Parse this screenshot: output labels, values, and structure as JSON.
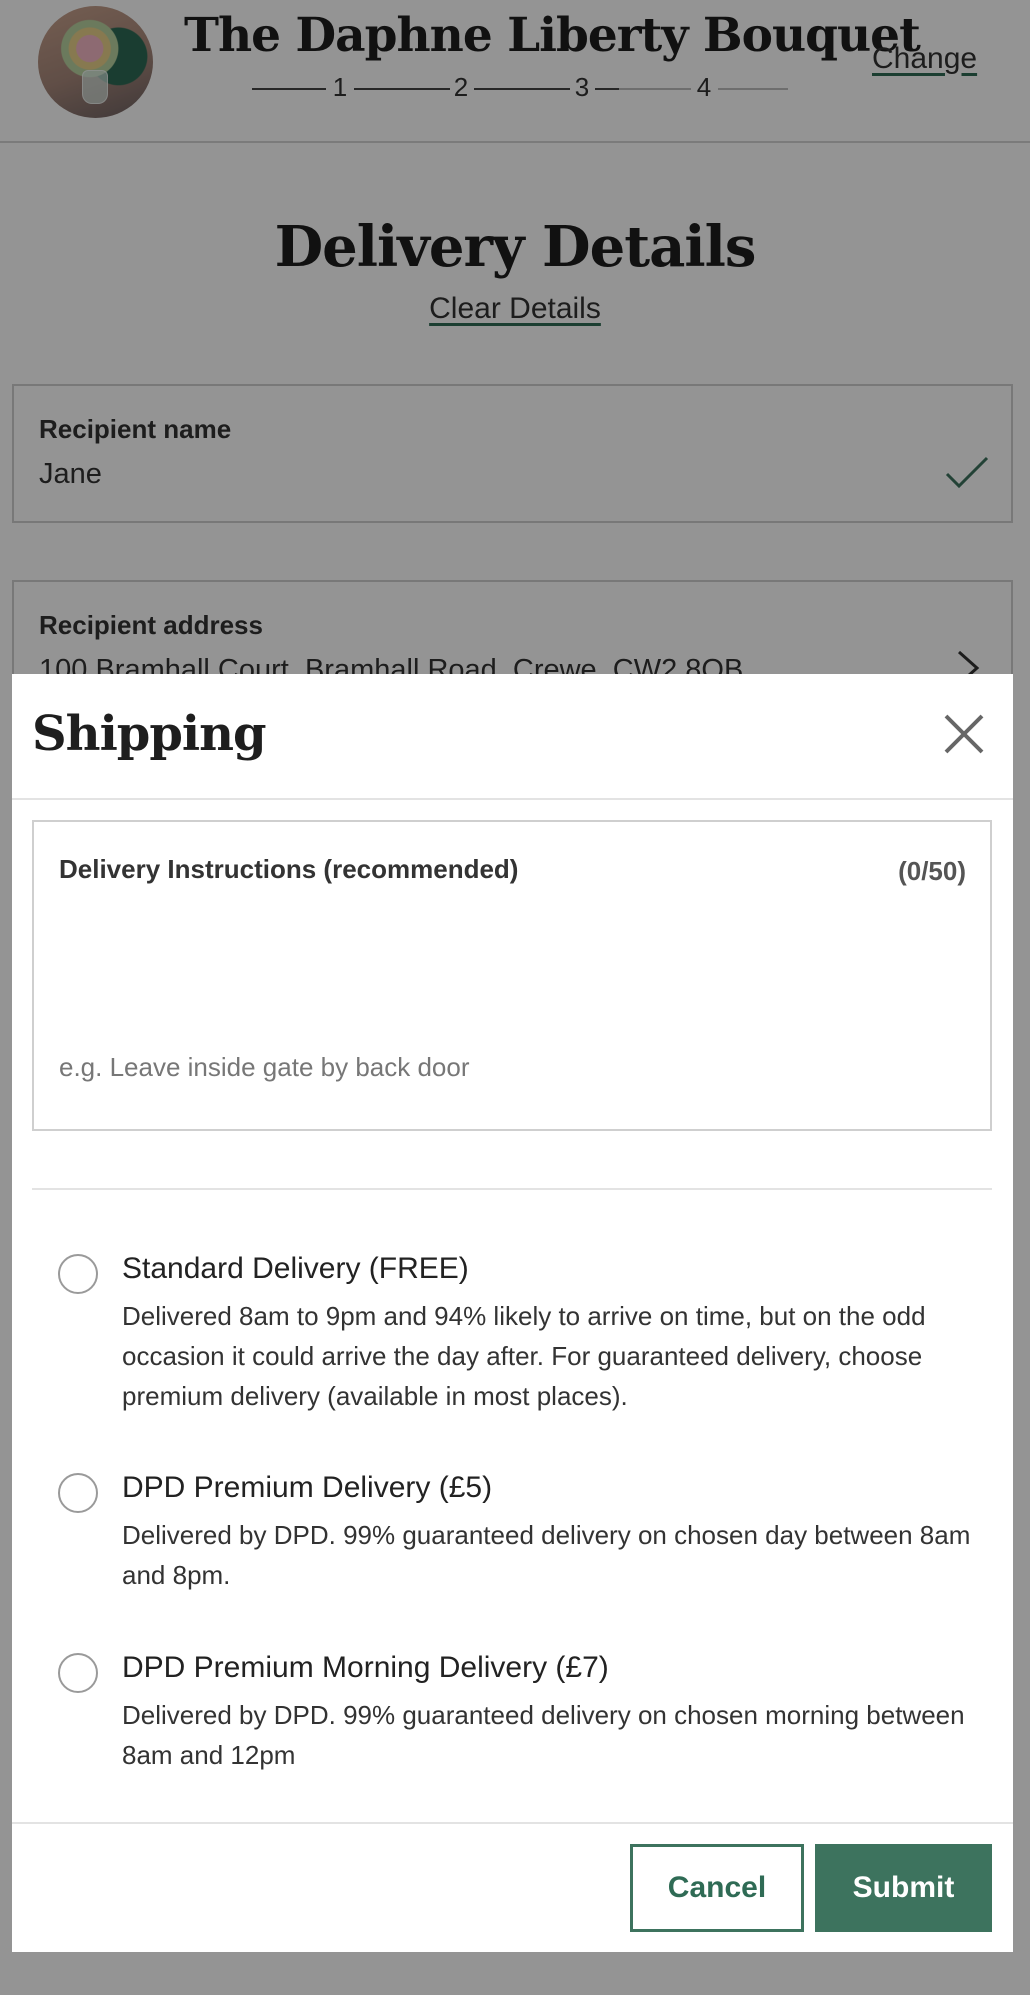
{
  "header": {
    "product_title": "The Daphne Liberty Bouquet",
    "change_label": "Change",
    "steps": [
      "1",
      "2",
      "3",
      "4"
    ]
  },
  "page": {
    "heading": "Delivery Details",
    "clear_label": "Clear Details",
    "recipient_name": {
      "label": "Recipient name",
      "value": "Jane"
    },
    "recipient_address": {
      "label": "Recipient address",
      "value": "100 Bramhall Court, Bramhall Road, Crewe, CW2 8QB"
    }
  },
  "modal": {
    "title": "Shipping",
    "instructions": {
      "label": "Delivery Instructions (recommended)",
      "counter": "(0/50)",
      "value": "",
      "placeholder": "e.g. Leave inside gate by back door"
    },
    "options": [
      {
        "title": "Standard Delivery (FREE)",
        "description": "Delivered 8am to 9pm and 94% likely to arrive on time, but on the odd occasion it could arrive the day after. For guaranteed delivery, choose premium delivery (available in most places).",
        "selected": false
      },
      {
        "title": "DPD Premium Delivery (£5)",
        "description": "Delivered by DPD. 99% guaranteed delivery on chosen day between 8am and 8pm.",
        "selected": false
      },
      {
        "title": "DPD Premium Morning Delivery (£7)",
        "description": "Delivered by DPD. 99% guaranteed delivery on chosen morning between 8am and 12pm",
        "selected": false
      }
    ],
    "cancel_label": "Cancel",
    "submit_label": "Submit"
  },
  "colors": {
    "accent_green": "#3d735e",
    "overlay": "rgba(0,0,0,0.42)"
  },
  "icons": {
    "close": "close-icon",
    "check": "checkmark-icon",
    "chevron": "chevron-right-icon"
  }
}
